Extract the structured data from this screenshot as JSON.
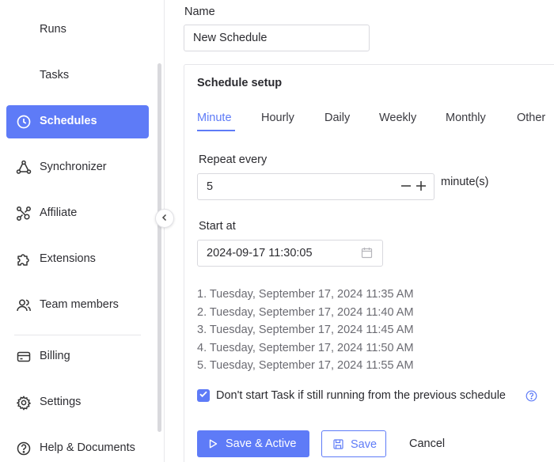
{
  "sidebar": {
    "items": [
      {
        "label": "Runs",
        "icon": "none"
      },
      {
        "label": "Tasks",
        "icon": "none"
      },
      {
        "label": "Schedules",
        "icon": "clock-icon",
        "active": true
      },
      {
        "label": "Synchronizer",
        "icon": "sync-icon"
      },
      {
        "label": "Affiliate",
        "icon": "affiliate-icon"
      },
      {
        "label": "Extensions",
        "icon": "puzzle-icon"
      },
      {
        "label": "Team members",
        "icon": "users-icon"
      },
      {
        "label": "Billing",
        "icon": "card-icon"
      },
      {
        "label": "Settings",
        "icon": "gear-icon"
      },
      {
        "label": "Help & Documents",
        "icon": "help-icon"
      }
    ]
  },
  "form": {
    "name_label": "Name",
    "name_value": "New Schedule"
  },
  "schedule": {
    "title": "Schedule setup",
    "tabs": [
      "Minute",
      "Hourly",
      "Daily",
      "Weekly",
      "Monthly",
      "Other"
    ],
    "active_tab": "Minute",
    "repeat_label": "Repeat every",
    "repeat_value": "5",
    "repeat_unit": "minute(s)",
    "start_label": "Start at",
    "start_value": "2024-09-17 11:30:05",
    "preview": [
      "1. Tuesday, September 17, 2024 11:35 AM",
      "2. Tuesday, September 17, 2024 11:40 AM",
      "3. Tuesday, September 17, 2024 11:45 AM",
      "4. Tuesday, September 17, 2024 11:50 AM",
      "5. Tuesday, September 17, 2024 11:55 AM"
    ],
    "skip_running_label": "Don't start Task if still running from the previous schedule",
    "skip_running_checked": true
  },
  "actions": {
    "save_active": "Save & Active",
    "save": "Save",
    "cancel": "Cancel"
  },
  "colors": {
    "accent": "#5e7bf7"
  }
}
